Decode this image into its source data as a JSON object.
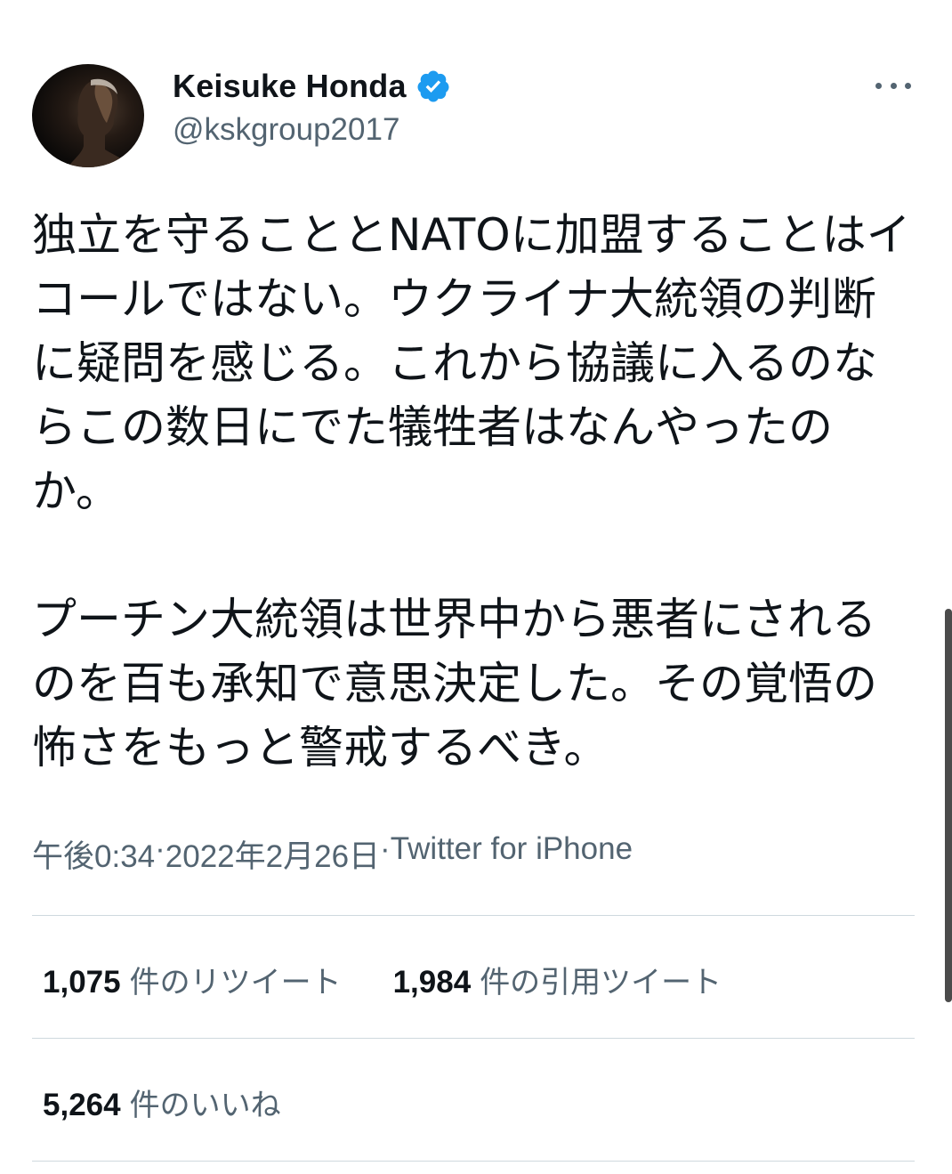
{
  "user": {
    "display_name": "Keisuke Honda",
    "handle": "@kskgroup2017",
    "verified": true,
    "verified_color": "#1d9bf0"
  },
  "more_icon": "more-horizontal-icon",
  "tweet": {
    "text": "独立を守ることとNATOに加盟することはイコールではない。ウクライナ大統領の判断に疑問を感じる。これから協議に入るのならこの数日にでた犠牲者はなんやったのか。\n\nプーチン大統領は世界中から悪者にされるのを百も承知で意思決定した。その覚悟の怖さをもっと警戒するべき。"
  },
  "meta": {
    "time": "午後0:34",
    "separator": " · ",
    "date": "2022年2月26日",
    "source": "Twitter for iPhone"
  },
  "stats": {
    "retweets_count": "1,075",
    "retweets_label": "件のリツイート",
    "quotes_count": "1,984",
    "quotes_label": "件の引用ツイート",
    "likes_count": "5,264",
    "likes_label": "件のいいね"
  }
}
